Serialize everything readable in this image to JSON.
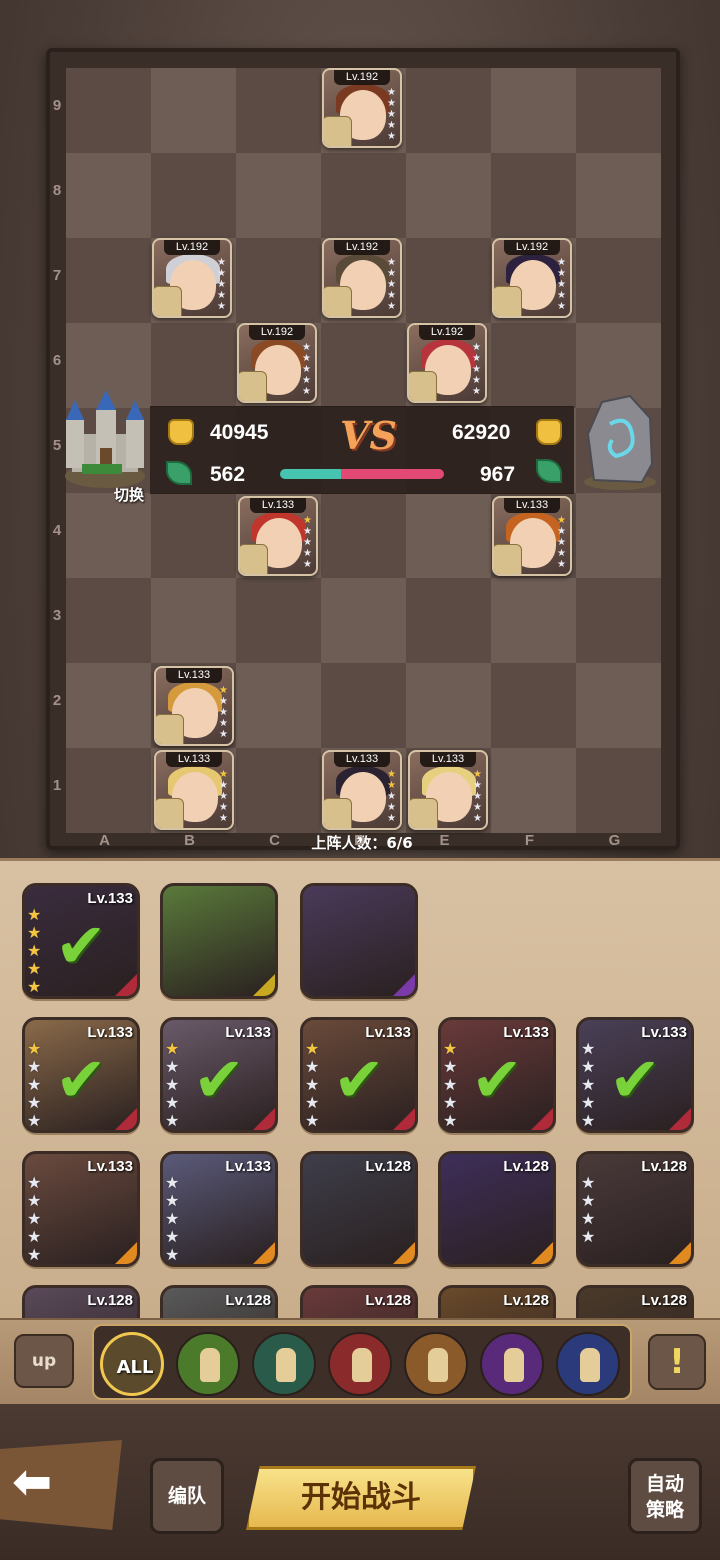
{
  "board": {
    "ranks": [
      "9",
      "8",
      "7",
      "6",
      "5",
      "4",
      "3",
      "2",
      "1"
    ],
    "files": [
      "A",
      "B",
      "C",
      "D",
      "E",
      "F",
      "G"
    ],
    "switch_label": "切换",
    "deploy_count": "上阵人数：6/6"
  },
  "enemy_units": [
    {
      "level": "Lv.192",
      "hair": "#7a3a22",
      "stars": 5,
      "gold": 0
    },
    {
      "level": "Lv.192",
      "hair": "#cfcfd6",
      "stars": 5,
      "gold": 0
    },
    {
      "level": "Lv.192",
      "hair": "#5a4a38",
      "stars": 5,
      "gold": 0
    },
    {
      "level": "Lv.192",
      "hair": "#2c2240",
      "stars": 5,
      "gold": 0
    },
    {
      "level": "Lv.192",
      "hair": "#8a4a24",
      "stars": 5,
      "gold": 0
    },
    {
      "level": "Lv.192",
      "hair": "#b8343c",
      "stars": 5,
      "gold": 0
    }
  ],
  "ally_units": [
    {
      "level": "Lv.133",
      "hair": "#c0362c",
      "stars": 5,
      "gold": 1
    },
    {
      "level": "Lv.133",
      "hair": "#c46420",
      "stars": 5,
      "gold": 1
    },
    {
      "level": "Lv.133",
      "hair": "#d49a3c",
      "stars": 5,
      "gold": 1
    },
    {
      "level": "Lv.133",
      "hair": "#e6c870",
      "stars": 5,
      "gold": 1
    },
    {
      "level": "Lv.133",
      "hair": "#2a2230",
      "stars": 5,
      "gold": 2
    },
    {
      "level": "Lv.133",
      "hair": "#e6d080",
      "stars": 5,
      "gold": 1
    }
  ],
  "versus": {
    "vs_label": "VS",
    "left_power": "40945",
    "right_power": "62920",
    "left_units": "562",
    "right_units": "967",
    "left_ratio": 0.37
  },
  "roster": [
    {
      "level": "Lv.133",
      "color": "#3a2c3e",
      "accent": "#b02a3a",
      "stars": 5,
      "gold": 5,
      "selected": true
    },
    {
      "level": "",
      "color": "#5a7a3a",
      "accent": "#c8a820",
      "stars": 0,
      "gold": 0,
      "selected": false
    },
    {
      "level": "",
      "color": "#4a3a5a",
      "accent": "#7a3aa8",
      "stars": 0,
      "gold": 0,
      "selected": false
    },
    {
      "level": "Lv.133",
      "color": "#8a6a4a",
      "accent": "#b02a3a",
      "stars": 5,
      "gold": 1,
      "selected": true
    },
    {
      "level": "Lv.133",
      "color": "#6a5a6a",
      "accent": "#b02a3a",
      "stars": 5,
      "gold": 1,
      "selected": true
    },
    {
      "level": "Lv.133",
      "color": "#6a4a3a",
      "accent": "#b02a3a",
      "stars": 5,
      "gold": 1,
      "selected": true
    },
    {
      "level": "Lv.133",
      "color": "#6a3a3a",
      "accent": "#b02a3a",
      "stars": 5,
      "gold": 1,
      "selected": true
    },
    {
      "level": "Lv.133",
      "color": "#4a4058",
      "accent": "#b02a3a",
      "stars": 5,
      "gold": 0,
      "selected": true
    },
    {
      "level": "Lv.133",
      "color": "#6a4a3e",
      "accent": "#e08a20",
      "stars": 5,
      "gold": 0,
      "selected": false
    },
    {
      "level": "Lv.133",
      "color": "#5a5a7a",
      "accent": "#e08a20",
      "stars": 5,
      "gold": 0,
      "selected": false
    },
    {
      "level": "Lv.128",
      "color": "#3e3e4a",
      "accent": "#e08a20",
      "stars": 0,
      "gold": 0,
      "selected": false
    },
    {
      "level": "Lv.128",
      "color": "#3e2e5a",
      "accent": "#e08a20",
      "stars": 0,
      "gold": 0,
      "selected": false
    },
    {
      "level": "Lv.128",
      "color": "#4a3a3a",
      "accent": "#e08a20",
      "stars": 4,
      "gold": 0,
      "selected": false
    },
    {
      "level": "Lv.128",
      "color": "#5a4a5a",
      "accent": "#e08a20",
      "stars": 0,
      "gold": 0,
      "selected": false
    },
    {
      "level": "Lv.128",
      "color": "#5a5a5a",
      "accent": "#e08a20",
      "stars": 0,
      "gold": 0,
      "selected": false
    },
    {
      "level": "Lv.128",
      "color": "#6a3a3a",
      "accent": "#e08a20",
      "stars": 0,
      "gold": 0,
      "selected": false
    },
    {
      "level": "Lv.128",
      "color": "#6a4a2a",
      "accent": "#e08a20",
      "stars": 0,
      "gold": 0,
      "selected": false
    },
    {
      "level": "Lv.128",
      "color": "#4a3a2a",
      "accent": "#e08a20",
      "stars": 0,
      "gold": 0,
      "selected": false
    }
  ],
  "filters": {
    "all_label": "ALL",
    "items": [
      {
        "icon": "knight-helmet-icon",
        "color": "#4a7a2a"
      },
      {
        "icon": "horse-icon",
        "color": "#2a5a4a"
      },
      {
        "icon": "cannon-icon",
        "color": "#8a2a2a"
      },
      {
        "icon": "chariot-icon",
        "color": "#8a5a2a"
      },
      {
        "icon": "mage-hat-icon",
        "color": "#5a2a7a"
      },
      {
        "icon": "priestess-icon",
        "color": "#2a3a7a"
      }
    ],
    "up_label": "up",
    "alert_label": "!"
  },
  "bottom": {
    "edit_team": "编队",
    "start_battle": "开始战斗",
    "auto_strategy_line1": "自动",
    "auto_strategy_line2": "策略"
  },
  "colors": {
    "ally_bar": "#47c4b0",
    "enemy_bar": "#e24a75",
    "star_gold": "#f5c542"
  }
}
